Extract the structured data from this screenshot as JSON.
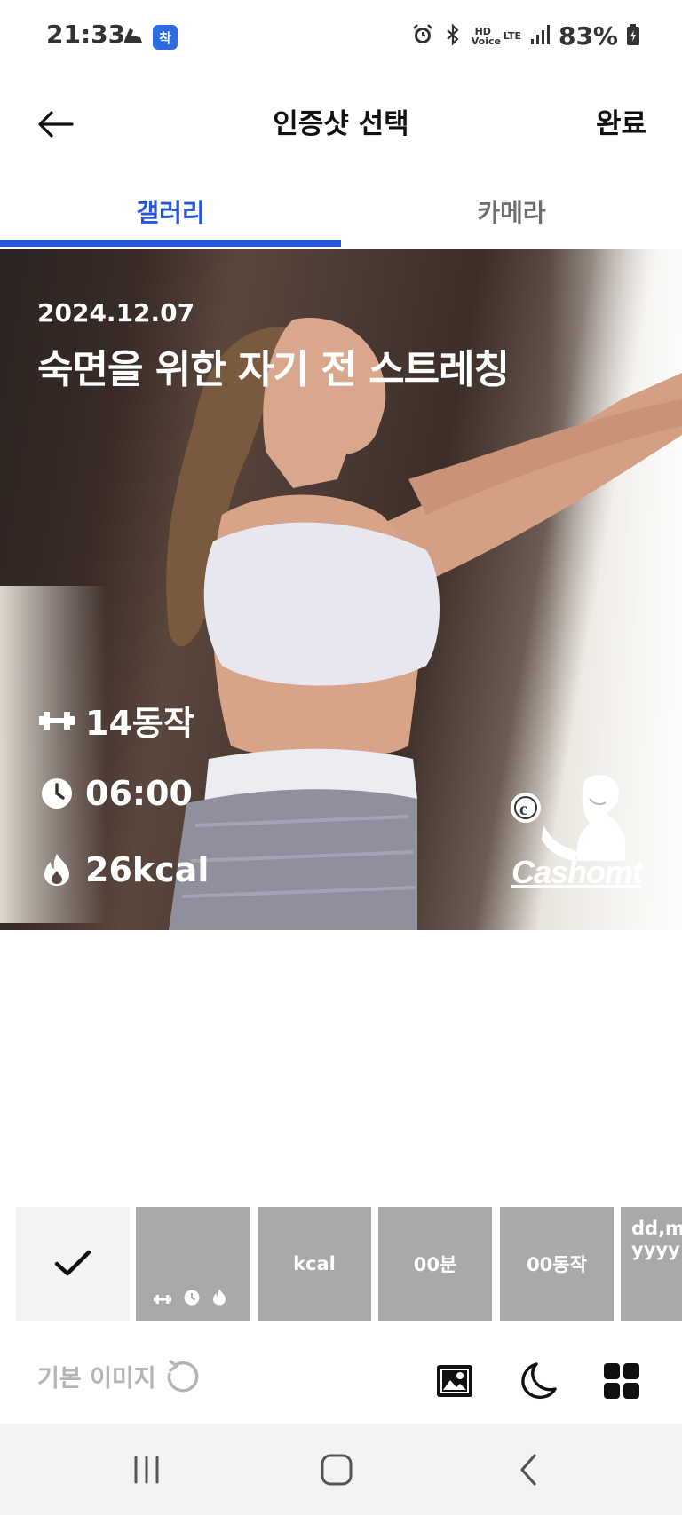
{
  "status_bar": {
    "time": "21:33",
    "app_badge": "착",
    "hd_voice": "HD Voice",
    "lte": "LTE",
    "battery": "83%"
  },
  "app_bar": {
    "title": "인증샷 선택",
    "done_label": "완료"
  },
  "tabs": [
    {
      "label": "갤러리",
      "selected": true
    },
    {
      "label": "카메라",
      "selected": false
    }
  ],
  "preview": {
    "date": "2024.12.07",
    "title": "숙면을 위한 자기 전 스트레칭",
    "moves": "14동작",
    "duration": "06:00",
    "kcal": "26kcal",
    "logo_text": "Cashomt"
  },
  "templates": [
    {
      "label": "",
      "selected": true,
      "icon": "check-icon"
    },
    {
      "label": "",
      "icons": [
        "dumbbell-icon",
        "clock-icon",
        "flame-icon"
      ]
    },
    {
      "label": "kcal"
    },
    {
      "label": "00분"
    },
    {
      "label": "00동작"
    },
    {
      "label": "dd,m yyyy"
    }
  ],
  "tools": {
    "reset_label": "기본 이미지"
  },
  "colors": {
    "accent": "#2756d8",
    "template_bg": "#a9a9a9",
    "muted_text": "#b5b5b5"
  }
}
